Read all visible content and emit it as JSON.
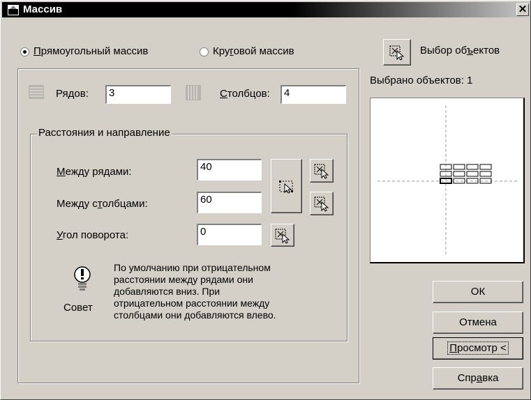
{
  "title": "Массив",
  "close_glyph": "✕",
  "mode": {
    "rect_pre": "",
    "rect_u": "П",
    "rect_post": "рямоугольный массив",
    "polar_pre": "Кру",
    "polar_u": "г",
    "polar_post": "овой массив",
    "selected": "rect"
  },
  "rows": {
    "label_pre": "Ря",
    "label_u": "д",
    "label_post": "ов:",
    "value": "3"
  },
  "cols": {
    "label_pre": "",
    "label_u": "С",
    "label_post": "толбцов:",
    "value": "4"
  },
  "group_title": "Расстояния и направление",
  "row_offset": {
    "label_pre": "",
    "label_u": "М",
    "label_post": "ежду рядами:",
    "value": "40"
  },
  "col_offset": {
    "label_pre": "Между с",
    "label_u": "т",
    "label_post": "олбцами:",
    "value": "60"
  },
  "angle": {
    "label_pre": "",
    "label_u": "У",
    "label_post": "гол поворота:",
    "value": "0"
  },
  "tip": {
    "label": "Совет",
    "lines": [
      "По умолчанию при отрицательном",
      "расстоянии между рядами они",
      "добавляются вниз. При",
      "отрицательном расстоянии между",
      "столбцами они добавляются влево."
    ]
  },
  "select_objects": {
    "pre": "Выбор об",
    "u": "ъ",
    "post": "ектов"
  },
  "selected_count": "Выбрано объектов: 1",
  "buttons": {
    "ok": "ОК",
    "cancel": "Отмена",
    "preview_u": "П",
    "preview_post": "росмотр <",
    "help_pre": "Спр",
    "help_u": "а",
    "help_post": "вка"
  },
  "preview_grid": {
    "rows": 3,
    "cols": 4
  }
}
